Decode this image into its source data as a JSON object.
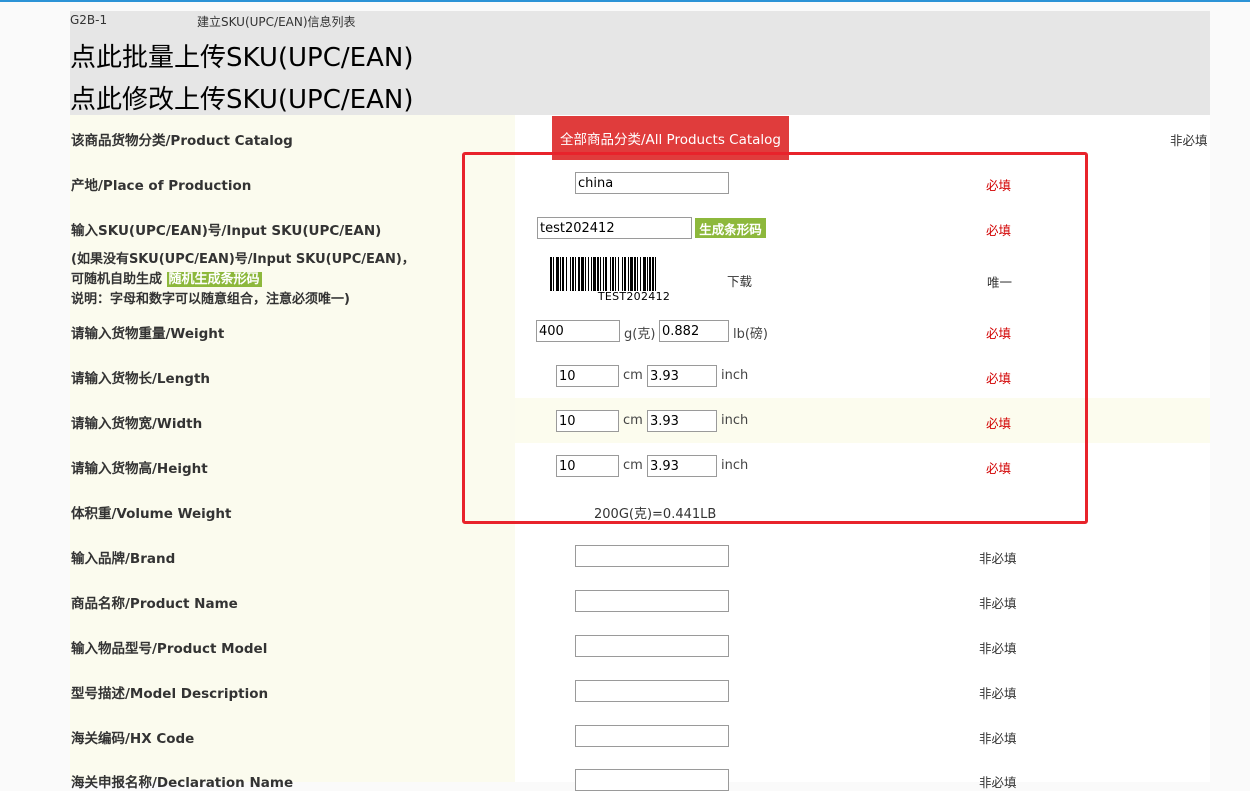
{
  "header": {
    "code": "G2B-1",
    "title": "建立SKU(UPC/EAN)信息列表",
    "batch_upload": "点此批量上传SKU(UPC/EAN)",
    "edit_upload": "点此修改上传SKU(UPC/EAN)"
  },
  "catalog": {
    "label": "该商品货物分类/Product Catalog",
    "button": "全部商品分类/All Products Catalog",
    "status": "非必填"
  },
  "origin": {
    "label": "产地/Place of Production",
    "value": "china",
    "status": "必填"
  },
  "sku": {
    "label": "输入SKU(UPC/EAN)号/Input SKU(UPC/EAN)",
    "value": "test202412",
    "generate_button": "生成条形码",
    "status": "必填"
  },
  "random": {
    "line1": "(如果没有SKU(UPC/EAN)号/Input SKU(UPC/EAN)，",
    "line2_prefix": "可随机自助生成",
    "random_button": "随机生成条形码",
    "line3": "说明：字母和数字可以随意组合，注意必须唯一)",
    "barcode_text": "TEST202412",
    "download": "下载",
    "status": "唯一"
  },
  "weight": {
    "label": "请输入货物重量/Weight",
    "grams": "400",
    "grams_unit": "g(克)",
    "pounds": "0.882",
    "pounds_unit": "lb(磅)",
    "status": "必填"
  },
  "length": {
    "label": "请输入货物长/Length",
    "cm": "10",
    "cm_unit": "cm",
    "inch": "3.93",
    "inch_unit": "inch",
    "status": "必填"
  },
  "width": {
    "label": "请输入货物宽/Width",
    "cm": "10",
    "cm_unit": "cm",
    "inch": "3.93",
    "inch_unit": "inch",
    "status": "必填"
  },
  "height": {
    "label": "请输入货物高/Height",
    "cm": "10",
    "cm_unit": "cm",
    "inch": "3.93",
    "inch_unit": "inch",
    "status": "必填"
  },
  "volume": {
    "label": "体积重/Volume Weight",
    "value": "200G(克)=0.441LB"
  },
  "brand": {
    "label": "输入品牌/Brand",
    "value": "",
    "status": "非必填"
  },
  "product_name": {
    "label": "商品名称/Product Name",
    "value": "",
    "status": "非必填"
  },
  "model": {
    "label": "输入物品型号/Product Model",
    "value": "",
    "status": "非必填"
  },
  "model_desc": {
    "label": "型号描述/Model Description",
    "value": "",
    "status": "非必填"
  },
  "hx_code": {
    "label": "海关编码/HX Code",
    "value": "",
    "status": "非必填"
  },
  "declaration": {
    "label": "海关申报名称/Declaration Name",
    "value": "",
    "status": "非必填"
  },
  "colors": {
    "required": "#d20000",
    "green": "#8db83c",
    "catalog_button": "#e03c3c",
    "highlight_box": "#e8232b"
  }
}
